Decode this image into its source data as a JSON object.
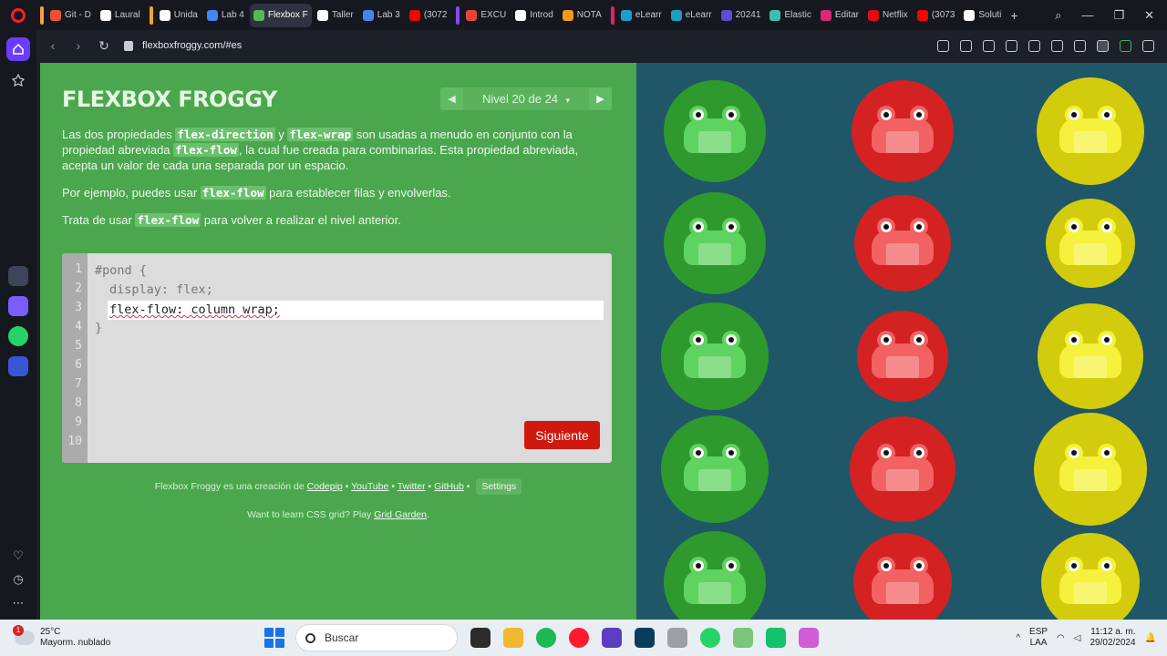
{
  "browser": {
    "tabs": [
      {
        "label": "Git - D",
        "color": "#f05133",
        "group": "#f2a33a"
      },
      {
        "label": "Laural",
        "color": "#ffffff",
        "group": null
      },
      {
        "label": "Unida",
        "color": "#ffffff",
        "group": "#f2a33a"
      },
      {
        "label": "Lab 4",
        "color": "#4285f4",
        "group": null
      },
      {
        "label": "Flexbox Fro",
        "color": "#57b955",
        "group": null,
        "active": true
      },
      {
        "label": "Taller",
        "color": "#ffffff",
        "group": null
      },
      {
        "label": "Lab 3",
        "color": "#4285f4",
        "group": null
      },
      {
        "label": "(3072",
        "color": "#ff0000",
        "group": null
      },
      {
        "label": "EXCU",
        "color": "#ea4335",
        "group": "#7c4dff"
      },
      {
        "label": "Introd",
        "color": "#ffffff",
        "group": null
      },
      {
        "label": "NOTA",
        "color": "#f29a1e",
        "group": null
      },
      {
        "label": "eLearr",
        "color": "#1aa0c8",
        "group": "#e0245e"
      },
      {
        "label": "eLearr",
        "color": "#1aa0c8",
        "group": null
      },
      {
        "label": "20241",
        "color": "#5a4fcf",
        "group": null
      },
      {
        "label": "Elastic",
        "color": "#3ebeb0",
        "group": null
      },
      {
        "label": "Editar",
        "color": "#d62976",
        "group": null
      },
      {
        "label": "Netflix",
        "color": "#e50914",
        "group": null
      },
      {
        "label": "(3073",
        "color": "#ff0000",
        "group": null
      },
      {
        "label": "Soluti",
        "color": "#ffffff",
        "group": null
      }
    ],
    "new_tab": "+",
    "url": "flexboxfroggy.com/#es"
  },
  "game": {
    "title": "FLEXBOX FROGGY",
    "level_text": "Nivel 20 de 24",
    "level_caret": "▾",
    "prev_arrow": "◀",
    "next_arrow": "▶",
    "instructions": {
      "p1_pre": "Las dos propiedades ",
      "p1_code1": "flex-direction",
      "p1_mid1": " y ",
      "p1_code2": "flex-wrap",
      "p1_mid2": " son usadas a menudo en conjunto con la propiedad abreviada ",
      "p1_code3": "flex-flow",
      "p1_post": ", la cual fue creada para combinarlas. Esta propiedad abreviada, acepta un valor de cada una separada por un espacio.",
      "p2_pre": "Por ejemplo, puedes usar ",
      "p2_code": "flex-flow",
      "p2_post": " para establecer filas y envolverlas.",
      "p3_pre": "Trata de usar ",
      "p3_code": "flex-flow",
      "p3_post": " para volver a realizar el nivel anterior."
    },
    "editor": {
      "line_numbers": [
        "1",
        "2",
        "3",
        "4",
        "5",
        "6",
        "7",
        "8",
        "9",
        "10"
      ],
      "line1": "#pond {",
      "line2": "display: flex;",
      "input_value": "flex-flow: column wrap;",
      "line4": "}"
    },
    "next_button": "Siguiente",
    "footer": {
      "prefix": "Flexbox Froggy es una creación de ",
      "codepip": "Codepip",
      "youtube": "YouTube",
      "twitter": "Twitter",
      "github": "GitHub",
      "sep": " • ",
      "settings": "Settings",
      "grid_pre": "Want to learn CSS grid? Play ",
      "grid_link": "Grid Garden",
      "grid_post": "."
    }
  },
  "taskbar": {
    "temperature": "25°C",
    "weather": "Mayorm. nublado",
    "weather_badge": "1",
    "search": "Buscar",
    "lang1": "ESP",
    "lang2": "LAA",
    "time": "11:12 a. m.",
    "date": "29/02/2024"
  },
  "colors": {
    "green_pad": "#2e9a2e",
    "green_frog": "#5fd35f",
    "red_pad": "#d42121",
    "red_frog": "#f26262",
    "yellow_pad": "#d2cc0c",
    "yellow_frog": "#f5f13c"
  }
}
